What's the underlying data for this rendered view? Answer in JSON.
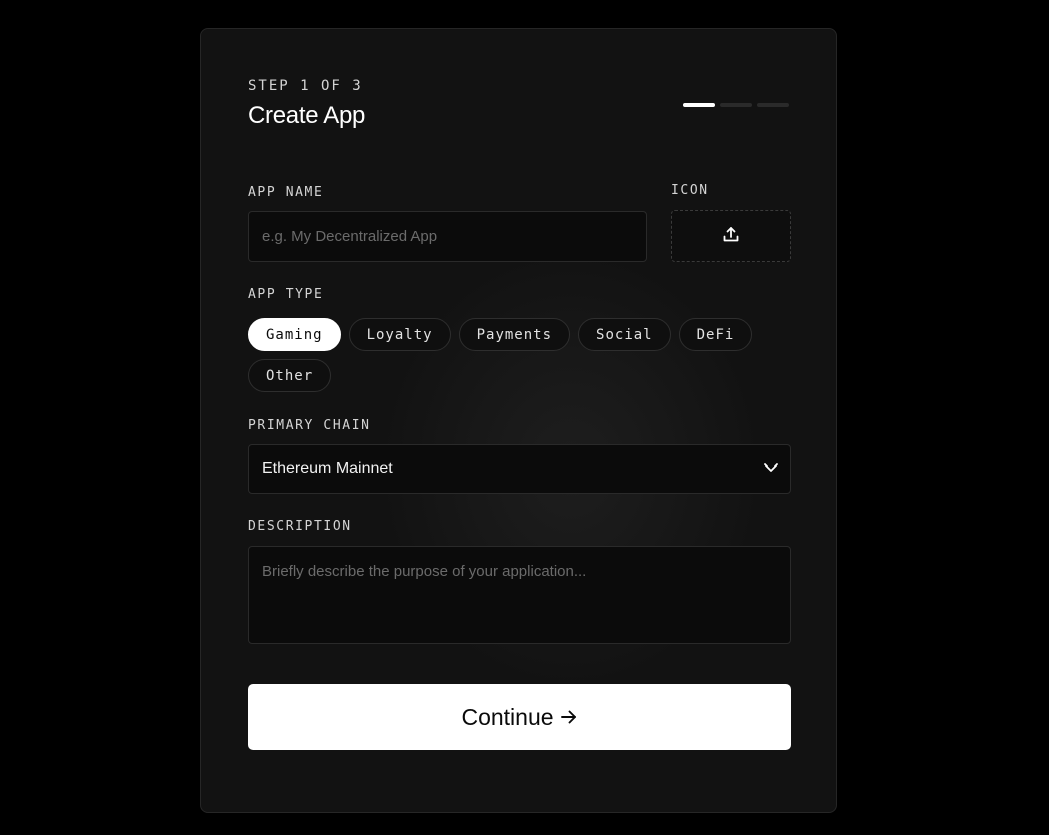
{
  "header": {
    "step": "STEP 1 OF 3",
    "title": "Create App",
    "progress": {
      "current_step": 1,
      "total_steps": 3
    }
  },
  "app_name": {
    "label": "APP NAME",
    "placeholder": "e.g. My Decentralized App",
    "value": ""
  },
  "icon": {
    "label": "ICON",
    "icon_name": "upload-icon"
  },
  "app_type": {
    "label": "APP TYPE",
    "options": [
      "Gaming",
      "Loyalty",
      "Payments",
      "Social",
      "DeFi",
      "Other"
    ],
    "selected": "Gaming"
  },
  "primary_chain": {
    "label": "PRIMARY CHAIN",
    "value": "Ethereum Mainnet",
    "icon_name": "chevron-down-icon"
  },
  "description": {
    "label": "DESCRIPTION",
    "placeholder": "Briefly describe the purpose of your application...",
    "value": ""
  },
  "actions": {
    "continue_label": "Continue",
    "continue_icon": "arrow-right-icon"
  },
  "colors": {
    "background": "#000000",
    "card": "#121212",
    "accent": "#ffffff",
    "text": "#ffffff",
    "muted": "#6b6b6b"
  }
}
